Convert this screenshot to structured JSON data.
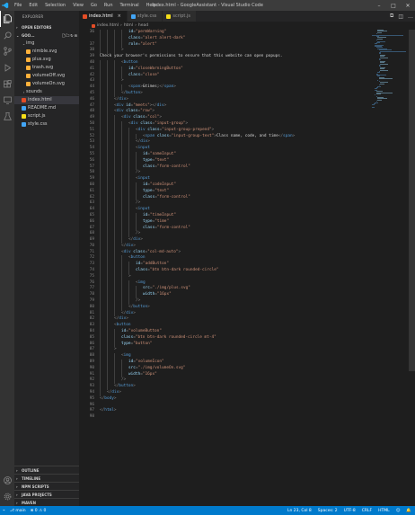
{
  "titlebar": {
    "menu": [
      "File",
      "Edit",
      "Selection",
      "View",
      "Go",
      "Run",
      "Terminal",
      "Help"
    ],
    "title": "index.html - GoogleAssistant - Visual Studio Code"
  },
  "sidebar": {
    "title": "EXPLORER",
    "open_editors": "OPEN EDITORS",
    "root": "GOO...",
    "items": [
      {
        "label": "img",
        "type": "folder",
        "depth": 1,
        "open": true
      },
      {
        "label": "nimble.svg",
        "type": "svg",
        "depth": 2
      },
      {
        "label": "plus.svg",
        "type": "svg",
        "depth": 2
      },
      {
        "label": "trash.svg",
        "type": "svg",
        "depth": 2
      },
      {
        "label": "volumeOff.svg",
        "type": "svg",
        "depth": 2
      },
      {
        "label": "volumeOn.svg",
        "type": "svg",
        "depth": 2
      },
      {
        "label": "sounds",
        "type": "folder",
        "depth": 1,
        "open": false
      },
      {
        "label": "index.html",
        "type": "html",
        "depth": 1,
        "selected": true
      },
      {
        "label": "README.md",
        "type": "md",
        "depth": 1
      },
      {
        "label": "script.js",
        "type": "js",
        "depth": 1
      },
      {
        "label": "style.css",
        "type": "css",
        "depth": 1
      }
    ],
    "bottom_sections": [
      "OUTLINE",
      "TIMELINE",
      "NPM SCRIPTS",
      "JAVA PROJECTS",
      "MAVEN"
    ]
  },
  "tabs": [
    {
      "label": "index.html",
      "type": "html",
      "active": true
    },
    {
      "label": "style.css",
      "type": "css",
      "active": false
    },
    {
      "label": "script.js",
      "type": "js",
      "active": false
    }
  ],
  "breadcrumb": [
    "index.html",
    "html",
    "head"
  ],
  "code": [
    {
      "n": "36",
      "indent": 4,
      "parts": [
        [
          "attr",
          "id"
        ],
        [
          "punc",
          "="
        ],
        [
          "str",
          "\"permWarning\""
        ]
      ]
    },
    {
      "n": "",
      "indent": 4,
      "parts": [
        [
          "attr",
          "class"
        ],
        [
          "punc",
          "="
        ],
        [
          "str",
          "\"alert alert-dark\""
        ]
      ]
    },
    {
      "n": "37",
      "indent": 4,
      "parts": [
        [
          "attr",
          "role"
        ],
        [
          "punc",
          "="
        ],
        [
          "str",
          "\"alert\""
        ]
      ]
    },
    {
      "n": "38",
      "indent": 3,
      "parts": [
        [
          "punc",
          ">"
        ]
      ]
    },
    {
      "n": "39",
      "indent": 0,
      "parts": [
        [
          "txt",
          "Check your browser's permissions to ensure that this website can open popups."
        ]
      ]
    },
    {
      "n": "40",
      "indent": 3,
      "parts": [
        [
          "punc",
          "<"
        ],
        [
          "tag",
          "button"
        ]
      ]
    },
    {
      "n": "41",
      "indent": 4,
      "parts": [
        [
          "attr",
          "id"
        ],
        [
          "punc",
          "="
        ],
        [
          "str",
          "\"closeWarningButton\""
        ]
      ]
    },
    {
      "n": "42",
      "indent": 4,
      "parts": [
        [
          "attr",
          "class"
        ],
        [
          "punc",
          "="
        ],
        [
          "str",
          "\"close\""
        ]
      ]
    },
    {
      "n": "43",
      "indent": 3,
      "parts": [
        [
          "punc",
          ">"
        ]
      ]
    },
    {
      "n": "44",
      "indent": 4,
      "parts": [
        [
          "punc",
          "<"
        ],
        [
          "tag",
          "span"
        ],
        [
          "punc",
          ">"
        ],
        [
          "txt",
          "&times;"
        ],
        [
          "punc",
          "</"
        ],
        [
          "tag",
          "span"
        ],
        [
          "punc",
          ">"
        ]
      ]
    },
    {
      "n": "45",
      "indent": 3,
      "parts": [
        [
          "punc",
          "</"
        ],
        [
          "tag",
          "button"
        ],
        [
          "punc",
          ">"
        ]
      ]
    },
    {
      "n": "46",
      "indent": 2,
      "parts": [
        [
          "punc",
          "</"
        ],
        [
          "tag",
          "div"
        ],
        [
          "punc",
          ">"
        ]
      ]
    },
    {
      "n": "47",
      "indent": 2,
      "parts": [
        [
          "punc",
          "<"
        ],
        [
          "tag",
          "div"
        ],
        [
          "txt",
          " "
        ],
        [
          "attr",
          "id"
        ],
        [
          "punc",
          "="
        ],
        [
          "str",
          "\"meets\""
        ],
        [
          "punc",
          "></"
        ],
        [
          "tag",
          "div"
        ],
        [
          "punc",
          ">"
        ]
      ]
    },
    {
      "n": "48",
      "indent": 2,
      "parts": [
        [
          "punc",
          "<"
        ],
        [
          "tag",
          "div"
        ],
        [
          "txt",
          " "
        ],
        [
          "attr",
          "class"
        ],
        [
          "punc",
          "="
        ],
        [
          "str",
          "\"row\""
        ],
        [
          "punc",
          ">"
        ]
      ]
    },
    {
      "n": "49",
      "indent": 3,
      "parts": [
        [
          "punc",
          "<"
        ],
        [
          "tag",
          "div"
        ],
        [
          "txt",
          " "
        ],
        [
          "attr",
          "class"
        ],
        [
          "punc",
          "="
        ],
        [
          "str",
          "\"col\""
        ],
        [
          "punc",
          ">"
        ]
      ]
    },
    {
      "n": "50",
      "indent": 4,
      "parts": [
        [
          "punc",
          "<"
        ],
        [
          "tag",
          "div"
        ],
        [
          "txt",
          " "
        ],
        [
          "attr",
          "class"
        ],
        [
          "punc",
          "="
        ],
        [
          "str",
          "\"input-group\""
        ],
        [
          "punc",
          ">"
        ]
      ]
    },
    {
      "n": "51",
      "indent": 5,
      "parts": [
        [
          "punc",
          "<"
        ],
        [
          "tag",
          "div"
        ],
        [
          "txt",
          " "
        ],
        [
          "attr",
          "class"
        ],
        [
          "punc",
          "="
        ],
        [
          "str",
          "\"input-group-prepend\""
        ],
        [
          "punc",
          ">"
        ]
      ]
    },
    {
      "n": "52",
      "indent": 6,
      "parts": [
        [
          "punc",
          "<"
        ],
        [
          "tag",
          "span"
        ],
        [
          "txt",
          " "
        ],
        [
          "attr",
          "class"
        ],
        [
          "punc",
          "="
        ],
        [
          "str",
          "\"input-group-text\""
        ],
        [
          "punc",
          ">"
        ],
        [
          "txt",
          "Class name, code, and time"
        ],
        [
          "punc",
          "</"
        ],
        [
          "tag",
          "span"
        ],
        [
          "punc",
          ">"
        ]
      ]
    },
    {
      "n": "53",
      "indent": 5,
      "parts": [
        [
          "punc",
          "</"
        ],
        [
          "tag",
          "div"
        ],
        [
          "punc",
          ">"
        ]
      ]
    },
    {
      "n": "54",
      "indent": 5,
      "parts": [
        [
          "punc",
          "<"
        ],
        [
          "tag",
          "input"
        ]
      ]
    },
    {
      "n": "55",
      "indent": 6,
      "parts": [
        [
          "attr",
          "id"
        ],
        [
          "punc",
          "="
        ],
        [
          "str",
          "\"nameInput\""
        ]
      ]
    },
    {
      "n": "56",
      "indent": 6,
      "parts": [
        [
          "attr",
          "type"
        ],
        [
          "punc",
          "="
        ],
        [
          "str",
          "\"text\""
        ]
      ]
    },
    {
      "n": "57",
      "indent": 6,
      "parts": [
        [
          "attr",
          "class"
        ],
        [
          "punc",
          "="
        ],
        [
          "str",
          "\"form-control\""
        ]
      ]
    },
    {
      "n": "58",
      "indent": 5,
      "parts": [
        [
          "punc",
          "/>"
        ]
      ]
    },
    {
      "n": "59",
      "indent": 5,
      "parts": [
        [
          "punc",
          "<"
        ],
        [
          "tag",
          "input"
        ]
      ]
    },
    {
      "n": "60",
      "indent": 6,
      "parts": [
        [
          "attr",
          "id"
        ],
        [
          "punc",
          "="
        ],
        [
          "str",
          "\"codeInput\""
        ]
      ]
    },
    {
      "n": "61",
      "indent": 6,
      "parts": [
        [
          "attr",
          "type"
        ],
        [
          "punc",
          "="
        ],
        [
          "str",
          "\"text\""
        ]
      ]
    },
    {
      "n": "62",
      "indent": 6,
      "parts": [
        [
          "attr",
          "class"
        ],
        [
          "punc",
          "="
        ],
        [
          "str",
          "\"form-control\""
        ]
      ]
    },
    {
      "n": "63",
      "indent": 5,
      "parts": [
        [
          "punc",
          "/>"
        ]
      ]
    },
    {
      "n": "64",
      "indent": 5,
      "parts": [
        [
          "punc",
          "<"
        ],
        [
          "tag",
          "input"
        ]
      ]
    },
    {
      "n": "65",
      "indent": 6,
      "parts": [
        [
          "attr",
          "id"
        ],
        [
          "punc",
          "="
        ],
        [
          "str",
          "\"timeInput\""
        ]
      ]
    },
    {
      "n": "66",
      "indent": 6,
      "parts": [
        [
          "attr",
          "type"
        ],
        [
          "punc",
          "="
        ],
        [
          "str",
          "\"time\""
        ]
      ]
    },
    {
      "n": "67",
      "indent": 6,
      "parts": [
        [
          "attr",
          "class"
        ],
        [
          "punc",
          "="
        ],
        [
          "str",
          "\"form-control\""
        ]
      ]
    },
    {
      "n": "68",
      "indent": 5,
      "parts": [
        [
          "punc",
          "/>"
        ]
      ]
    },
    {
      "n": "69",
      "indent": 4,
      "parts": [
        [
          "punc",
          "</"
        ],
        [
          "tag",
          "div"
        ],
        [
          "punc",
          ">"
        ]
      ]
    },
    {
      "n": "70",
      "indent": 3,
      "parts": [
        [
          "punc",
          "</"
        ],
        [
          "tag",
          "div"
        ],
        [
          "punc",
          ">"
        ]
      ]
    },
    {
      "n": "71",
      "indent": 3,
      "parts": [
        [
          "punc",
          "<"
        ],
        [
          "tag",
          "div"
        ],
        [
          "txt",
          " "
        ],
        [
          "attr",
          "class"
        ],
        [
          "punc",
          "="
        ],
        [
          "str",
          "\"col-md-auto\""
        ],
        [
          "punc",
          ">"
        ]
      ]
    },
    {
      "n": "72",
      "indent": 4,
      "parts": [
        [
          "punc",
          "<"
        ],
        [
          "tag",
          "button"
        ]
      ]
    },
    {
      "n": "73",
      "indent": 5,
      "parts": [
        [
          "attr",
          "id"
        ],
        [
          "punc",
          "="
        ],
        [
          "str",
          "\"addButton\""
        ]
      ]
    },
    {
      "n": "74",
      "indent": 5,
      "parts": [
        [
          "attr",
          "class"
        ],
        [
          "punc",
          "="
        ],
        [
          "str",
          "\"btn btn-dark rounded-circle\""
        ]
      ]
    },
    {
      "n": "75",
      "indent": 4,
      "parts": [
        [
          "punc",
          ">"
        ]
      ]
    },
    {
      "n": "76",
      "indent": 5,
      "parts": [
        [
          "punc",
          "<"
        ],
        [
          "tag",
          "img"
        ]
      ]
    },
    {
      "n": "77",
      "indent": 6,
      "parts": [
        [
          "attr",
          "src"
        ],
        [
          "punc",
          "="
        ],
        [
          "str",
          "\"./img/plus.svg\""
        ]
      ]
    },
    {
      "n": "78",
      "indent": 6,
      "parts": [
        [
          "attr",
          "width"
        ],
        [
          "punc",
          "="
        ],
        [
          "str",
          "\"16px\""
        ]
      ]
    },
    {
      "n": "79",
      "indent": 5,
      "parts": [
        [
          "punc",
          "/>"
        ]
      ]
    },
    {
      "n": "80",
      "indent": 4,
      "parts": [
        [
          "punc",
          "</"
        ],
        [
          "tag",
          "button"
        ],
        [
          "punc",
          ">"
        ]
      ]
    },
    {
      "n": "81",
      "indent": 3,
      "parts": [
        [
          "punc",
          "</"
        ],
        [
          "tag",
          "div"
        ],
        [
          "punc",
          ">"
        ]
      ]
    },
    {
      "n": "82",
      "indent": 2,
      "parts": [
        [
          "punc",
          "</"
        ],
        [
          "tag",
          "div"
        ],
        [
          "punc",
          ">"
        ]
      ]
    },
    {
      "n": "83",
      "indent": 2,
      "parts": [
        [
          "punc",
          "<"
        ],
        [
          "tag",
          "button"
        ]
      ]
    },
    {
      "n": "84",
      "indent": 3,
      "parts": [
        [
          "attr",
          "id"
        ],
        [
          "punc",
          "="
        ],
        [
          "str",
          "\"volumeButton\""
        ]
      ]
    },
    {
      "n": "85",
      "indent": 3,
      "parts": [
        [
          "attr",
          "class"
        ],
        [
          "punc",
          "="
        ],
        [
          "str",
          "\"btn btn-dark rounded-circle mt-4\""
        ]
      ]
    },
    {
      "n": "86",
      "indent": 3,
      "parts": [
        [
          "attr",
          "type"
        ],
        [
          "punc",
          "="
        ],
        [
          "str",
          "\"button\""
        ]
      ]
    },
    {
      "n": "87",
      "indent": 2,
      "parts": [
        [
          "punc",
          ">"
        ]
      ]
    },
    {
      "n": "88",
      "indent": 3,
      "parts": [
        [
          "punc",
          "<"
        ],
        [
          "tag",
          "img"
        ]
      ]
    },
    {
      "n": "89",
      "indent": 4,
      "parts": [
        [
          "attr",
          "id"
        ],
        [
          "punc",
          "="
        ],
        [
          "str",
          "\"volumeIcon\""
        ]
      ]
    },
    {
      "n": "90",
      "indent": 4,
      "parts": [
        [
          "attr",
          "src"
        ],
        [
          "punc",
          "="
        ],
        [
          "str",
          "\"./img/volumeOn.svg\""
        ]
      ]
    },
    {
      "n": "91",
      "indent": 4,
      "parts": [
        [
          "attr",
          "width"
        ],
        [
          "punc",
          "="
        ],
        [
          "str",
          "\"16px\""
        ]
      ]
    },
    {
      "n": "92",
      "indent": 3,
      "parts": [
        [
          "punc",
          "/>"
        ]
      ]
    },
    {
      "n": "93",
      "indent": 2,
      "parts": [
        [
          "punc",
          "</"
        ],
        [
          "tag",
          "button"
        ],
        [
          "punc",
          ">"
        ]
      ]
    },
    {
      "n": "94",
      "indent": 1,
      "parts": [
        [
          "punc",
          "</"
        ],
        [
          "tag",
          "div"
        ],
        [
          "punc",
          ">"
        ]
      ]
    },
    {
      "n": "95",
      "indent": 0,
      "parts": [
        [
          "punc",
          "</"
        ],
        [
          "tag",
          "body"
        ],
        [
          "punc",
          ">"
        ]
      ]
    },
    {
      "n": "96",
      "indent": 0,
      "parts": []
    },
    {
      "n": "97",
      "indent": 0,
      "parts": [
        [
          "punc",
          "</"
        ],
        [
          "tag",
          "html"
        ],
        [
          "punc",
          ">"
        ]
      ]
    },
    {
      "n": "98",
      "indent": 0,
      "parts": []
    }
  ],
  "statusbar": {
    "branch": "main",
    "problems": "⊗ 0 ⚠ 0",
    "position": "Ln 23, Col 8",
    "spaces": "Spaces: 2",
    "encoding": "UTF-8",
    "eol": "CRLF",
    "language": "HTML"
  },
  "colors": {
    "accent": "#007acc",
    "html": "#e44d26",
    "css": "#42a5f5",
    "js": "#f5de19",
    "svg": "#ffb13b",
    "md": "#42a5f5",
    "folder": "#90a4ae"
  }
}
